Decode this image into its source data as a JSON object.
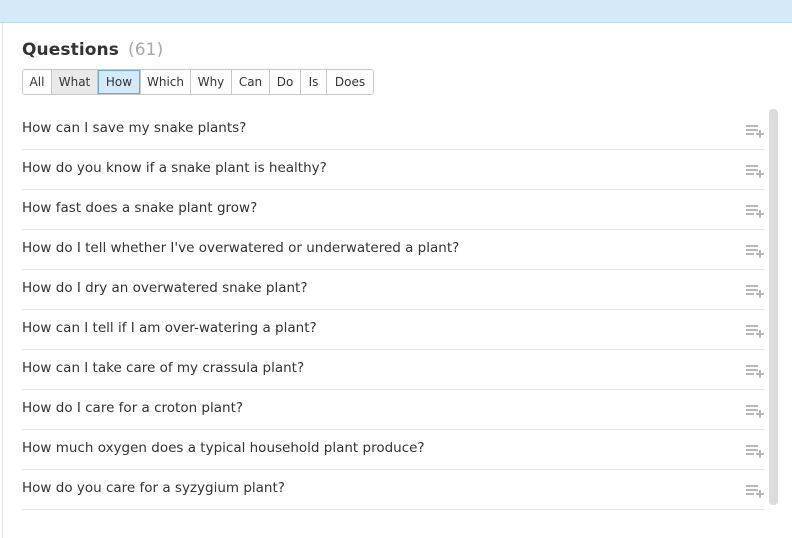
{
  "questions_panel": {
    "title": "Questions",
    "count": "(61)",
    "filters": [
      {
        "label": "All",
        "state": "normal"
      },
      {
        "label": "What",
        "state": "hovered"
      },
      {
        "label": "How",
        "state": "active"
      },
      {
        "label": "Which",
        "state": "normal"
      },
      {
        "label": "Why",
        "state": "normal"
      },
      {
        "label": "Can",
        "state": "normal"
      },
      {
        "label": "Do",
        "state": "normal"
      },
      {
        "label": "Is",
        "state": "normal"
      },
      {
        "label": "Does",
        "state": "normal"
      }
    ],
    "questions": [
      "How can I save my snake plants?",
      "How do you know if a snake plant is healthy?",
      "How fast does a snake plant grow?",
      "How do I tell whether I've overwatered or underwatered a plant?",
      "How do I dry an overwatered snake plant?",
      "How can I tell if I am over-watering a plant?",
      "How can I take care of my crassula plant?",
      "How do I care for a croton plant?",
      "How much oxygen does a typical household plant produce?",
      "How do you care for a syzygium plant?"
    ],
    "add_icon": "add-to-list-icon",
    "accent_color": "#d6e9f8"
  }
}
